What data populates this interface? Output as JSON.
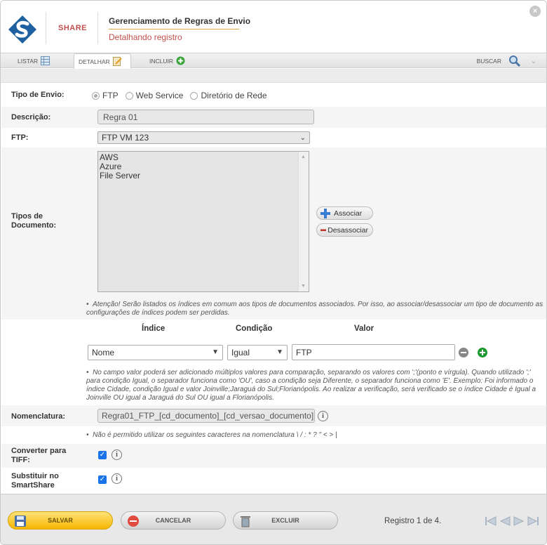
{
  "header": {
    "brand": "SHARE",
    "title": "Gerenciamento de Regras de Envio",
    "subtitle": "Detalhando registro",
    "close_label": "×"
  },
  "tabs": [
    {
      "label": "LISTAR",
      "icon": "grid-icon"
    },
    {
      "label": "DETALHAR",
      "icon": "edit-icon"
    },
    {
      "label": "INCLUIR",
      "icon": "plus-circle-icon"
    }
  ],
  "search_label": "BUSCAR",
  "form": {
    "tipo_envio_label": "Tipo de Envio:",
    "tipo_envio_options": [
      "FTP",
      "Web Service",
      "Diretório de Rede"
    ],
    "tipo_envio_selected": "FTP",
    "descricao_label": "Descrição:",
    "descricao_value": "Regra 01",
    "ftp_label": "FTP:",
    "ftp_value": "FTP VM 123",
    "tipos_doc_label_1": "Tipos de",
    "tipos_doc_label_2": "Documento:",
    "tipos_doc_items": [
      "AWS",
      "Azure",
      "File Server"
    ],
    "associar_label": "Associar",
    "desassociar_label": "Desassociar",
    "note_tipos": "Atenção! Serão listados os índices em comum aos tipos de documentos associados. Por isso, ao associar/desassociar um tipo de documento as configurações de índices podem ser perdidas.",
    "col_indice": "Índice",
    "col_condicao": "Condição",
    "col_valor": "Valor",
    "indice_value": "Nome",
    "condicao_value": "Igual",
    "valor_value": "FTP",
    "note_valor": "No campo valor poderá ser adicionado múltiplos valores para comparação, separando os valores com ';'(ponto e vírgula). Quando utilizado ';' para condição Igual, o separador funciona como 'OU', caso a condição seja Diferente, o separador funciona como 'E'. Exemplo: Foi informado o índice Cidade, condição Igual e valor Joinville;Jaraguá do Sul;Florianópolis. Ao realizar a verificação, será verificado se o índice Cidade é Igual a Joinville OU igual a Jaraguá do Sul OU igual a Florianópolis.",
    "nomenclatura_label": "Nomenclatura:",
    "nomenclatura_value": "Regra01_FTP_[cd_documento]_[cd_versao_documento]",
    "note_nomenclatura": "Não é permitido utilizar os seguintes caracteres na nomenclatura \\ / : * ? \" < > |",
    "converter_label_1": "Converter para",
    "converter_label_2": "TIFF:",
    "converter_checked": true,
    "substituir_label_1": "Substituir no",
    "substituir_label_2": "SmartShare",
    "substituir_checked": true
  },
  "footer": {
    "save_label": "SALVAR",
    "cancel_label": "CANCELAR",
    "delete_label": "EXCLUIR",
    "record_text": "Registro 1 de 4."
  },
  "colors": {
    "brand_red": "#c0504d",
    "save_yellow": "#f5b500",
    "check_blue": "#1a73e8"
  }
}
